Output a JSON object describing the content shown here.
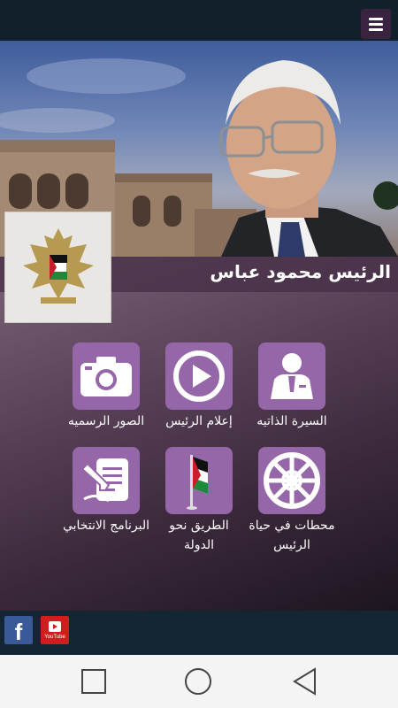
{
  "header": {
    "menu_icon": "hamburger-menu-icon"
  },
  "hero": {
    "president_name": "الرئيس محمود عباس",
    "emblem_icon": "palestine-eagle-emblem"
  },
  "tiles": [
    {
      "label": "السيرة الذاتيه",
      "icon": "person-suit-icon"
    },
    {
      "label": "إعلام الرئيس",
      "icon": "play-icon"
    },
    {
      "label": "الصور الرسميه",
      "icon": "camera-icon"
    },
    {
      "label": "محطات في حياة الرئيس",
      "icon": "wheel-icon"
    },
    {
      "label": "الطريق نحو الدولة",
      "icon": "flag-icon"
    },
    {
      "label": "البرنامج الانتخابي",
      "icon": "document-pen-icon"
    }
  ],
  "social": {
    "facebook_letter": "f",
    "youtube_text": "YouTube"
  },
  "nav": {
    "recents": "square-icon",
    "home": "circle-icon",
    "back": "triangle-back-icon"
  },
  "colors": {
    "tile": "#9566a8",
    "topbar": "#12202c",
    "accent": "#3a2340"
  }
}
